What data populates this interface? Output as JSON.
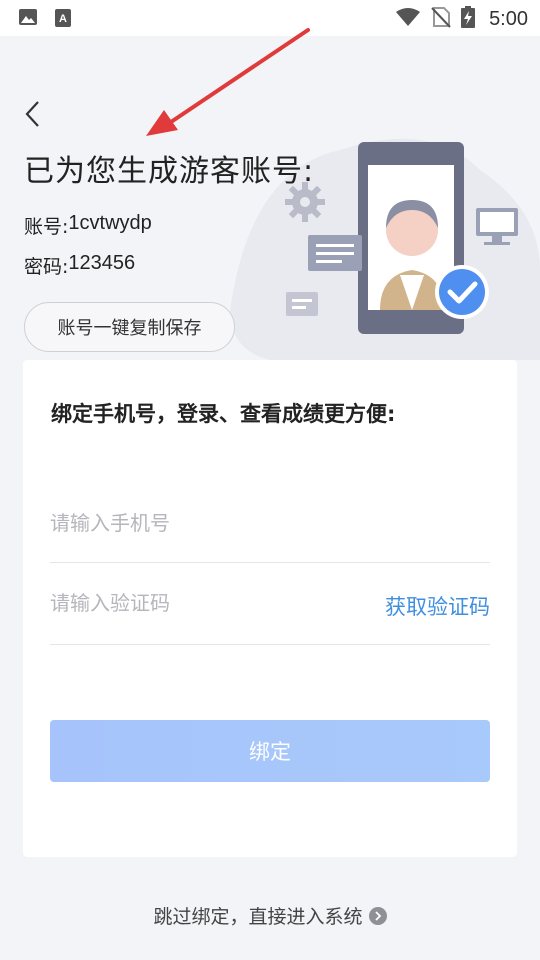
{
  "status_bar": {
    "time": "5:00",
    "icons": [
      "image-icon",
      "text-a-icon",
      "wifi-icon",
      "no-sim-icon",
      "battery-charging-icon"
    ]
  },
  "nav": {
    "back_icon": "chevron-left-icon"
  },
  "header": {
    "title": "已为您生成游客账号:",
    "account_label": "账号:",
    "account_value": "1cvtwydp",
    "password_label": "密码:",
    "password_value": "123456",
    "copy_button_label": "账号一键复制保存"
  },
  "card": {
    "heading": "绑定手机号，登录、查看成绩更方便:",
    "phone_placeholder": "请输入手机号",
    "phone_value": "",
    "code_placeholder": "请输入验证码",
    "code_value": "",
    "get_code_label": "获取验证码",
    "bind_button_label": "绑定"
  },
  "footer": {
    "skip_label": "跳过绑定，直接进入系统"
  },
  "colors": {
    "accent": "#3f8fe0",
    "bind_button": "#a6c4fb",
    "annotation_arrow": "#e03a3a",
    "background": "#f3f4f8"
  }
}
